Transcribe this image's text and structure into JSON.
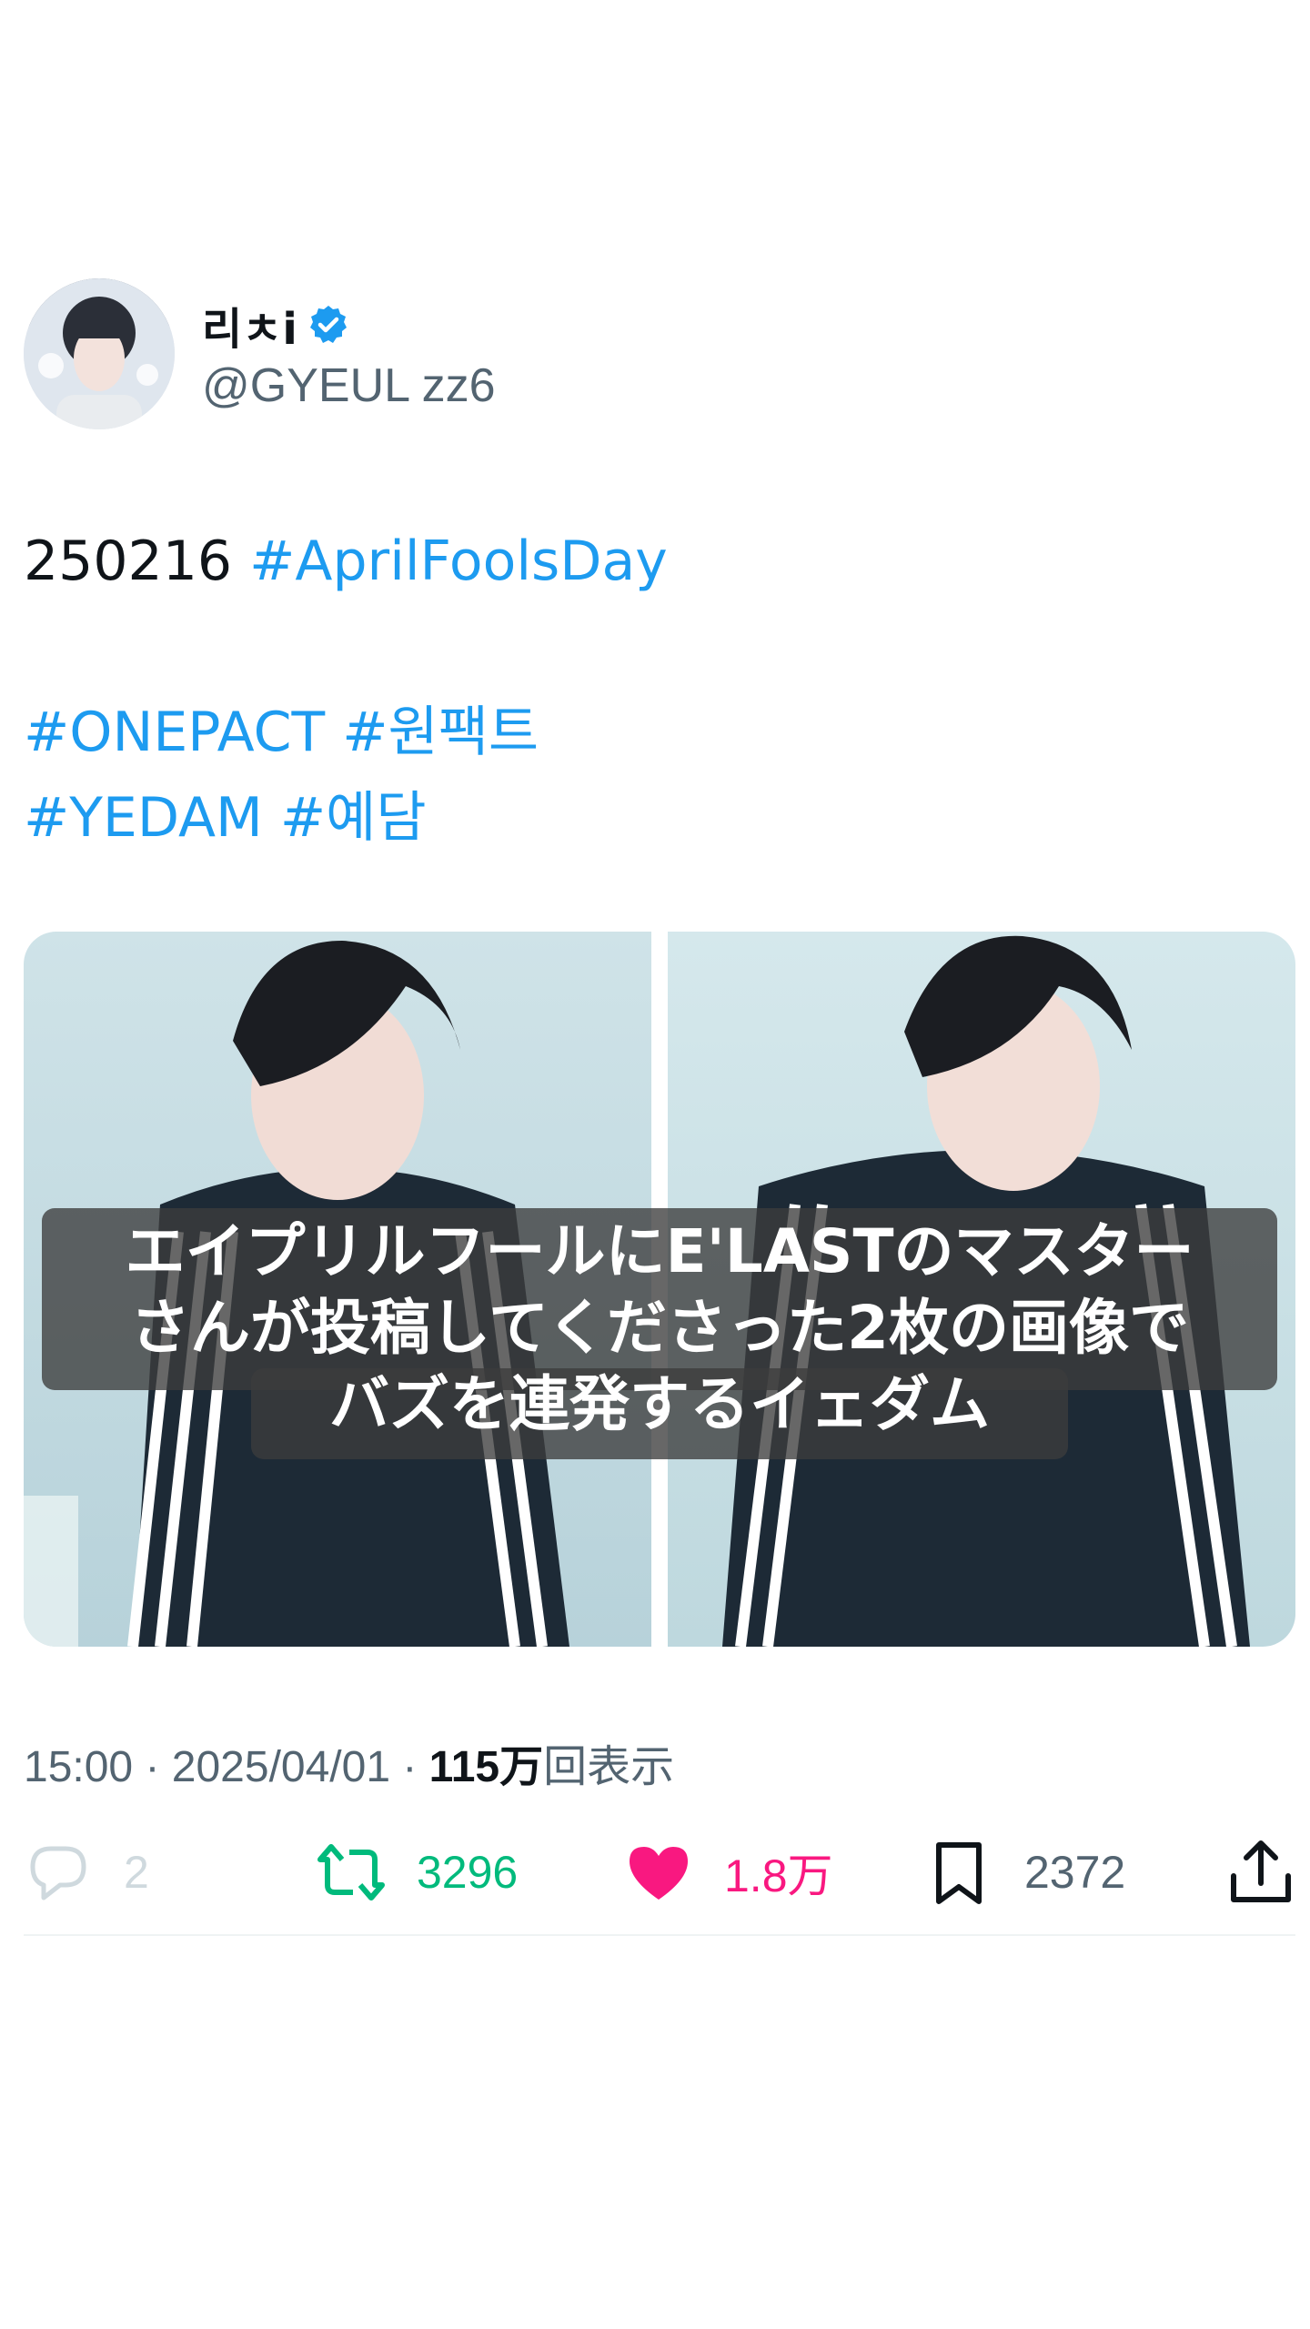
{
  "author": {
    "display_name": "리ㅊi",
    "handle": "@GYEUL zz6",
    "verified": true
  },
  "tweet": {
    "lines": [
      [
        {
          "text": "250216 ",
          "tag": false
        },
        {
          "text": "#AprilFoolsDay",
          "tag": true
        }
      ],
      [],
      [
        {
          "text": "#ONEPACT",
          "tag": true
        },
        {
          "text": " ",
          "tag": false
        },
        {
          "text": "#원팩트",
          "tag": true
        }
      ],
      [
        {
          "text": "#YEDAM",
          "tag": true
        },
        {
          "text": " ",
          "tag": false
        },
        {
          "text": "#예담",
          "tag": true
        }
      ]
    ]
  },
  "media": {
    "caption_lines": [
      "エイプリルフールにE'LASTのマスター",
      "さんが投稿してくださった2枚の画像で",
      "バズを連発するイェダム"
    ]
  },
  "meta": {
    "time": "15:00",
    "separator": " · ",
    "date": "2025/04/01",
    "views_count": "115万",
    "views_label": "回表示"
  },
  "actions": {
    "reply_count": "2",
    "retweet_count": "3296",
    "like_count": "1.8万",
    "bookmark_count": "2372"
  },
  "colors": {
    "link": "#1d9bf0",
    "retweet": "#00ba7c",
    "like": "#f91880",
    "muted": "#536471"
  },
  "icons": [
    "verified-badge-icon",
    "reply-icon",
    "retweet-icon",
    "like-heart-icon",
    "bookmark-icon",
    "share-icon"
  ]
}
